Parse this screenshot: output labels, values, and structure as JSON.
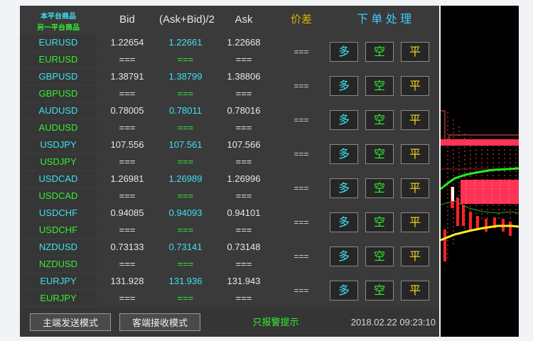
{
  "header": {
    "platform_label": "本平台商品",
    "other_platform_label": "另一平台商品",
    "bid_label": "Bid",
    "mid_label": "(Ask+Bid)/2",
    "ask_label": "Ask",
    "spread_label": "价差",
    "order_label": "下 单 处 理"
  },
  "rows": [
    {
      "symbol": "EURUSD",
      "bid": "1.22654",
      "mid": "1.22661",
      "ask": "1.22668",
      "other_symbol": "EURUSD",
      "other_bid": "===",
      "other_mid": "===",
      "other_ask": "===",
      "spread": "==="
    },
    {
      "symbol": "GBPUSD",
      "bid": "1.38791",
      "mid": "1.38799",
      "ask": "1.38806",
      "other_symbol": "GBPUSD",
      "other_bid": "===",
      "other_mid": "===",
      "other_ask": "===",
      "spread": "==="
    },
    {
      "symbol": "AUDUSD",
      "bid": "0.78005",
      "mid": "0.78011",
      "ask": "0.78016",
      "other_symbol": "AUDUSD",
      "other_bid": "===",
      "other_mid": "===",
      "other_ask": "===",
      "spread": "==="
    },
    {
      "symbol": "USDJPY",
      "bid": "107.556",
      "mid": "107.561",
      "ask": "107.566",
      "other_symbol": "USDJPY",
      "other_bid": "===",
      "other_mid": "===",
      "other_ask": "===",
      "spread": "==="
    },
    {
      "symbol": "USDCAD",
      "bid": "1.26981",
      "mid": "1.26989",
      "ask": "1.26996",
      "other_symbol": "USDCAD",
      "other_bid": "===",
      "other_mid": "===",
      "other_ask": "===",
      "spread": "==="
    },
    {
      "symbol": "USDCHF",
      "bid": "0.94085",
      "mid": "0.94093",
      "ask": "0.94101",
      "other_symbol": "USDCHF",
      "other_bid": "===",
      "other_mid": "===",
      "other_ask": "===",
      "spread": "==="
    },
    {
      "symbol": "NZDUSD",
      "bid": "0.73133",
      "mid": "0.73141",
      "ask": "0.73148",
      "other_symbol": "NZDUSD",
      "other_bid": "===",
      "other_mid": "===",
      "other_ask": "===",
      "spread": "==="
    },
    {
      "symbol": "EURJPY",
      "bid": "131.928",
      "mid": "131.936",
      "ask": "131.943",
      "other_symbol": "EURJPY",
      "other_bid": "===",
      "other_mid": "===",
      "other_ask": "===",
      "spread": "==="
    }
  ],
  "buttons": {
    "long": "多",
    "short": "空",
    "close": "平"
  },
  "footer": {
    "master_mode": "主端发送模式",
    "slave_mode": "客端接收模式",
    "alert_only": "只报警提示",
    "datetime": "2018.02.22 09:23:10"
  },
  "colors": {
    "cyan": "#3ee0f0",
    "green": "#33ee33",
    "yellow": "#f0d020",
    "spread_header": "#d8b400",
    "order_header": "#3ec8ff"
  }
}
